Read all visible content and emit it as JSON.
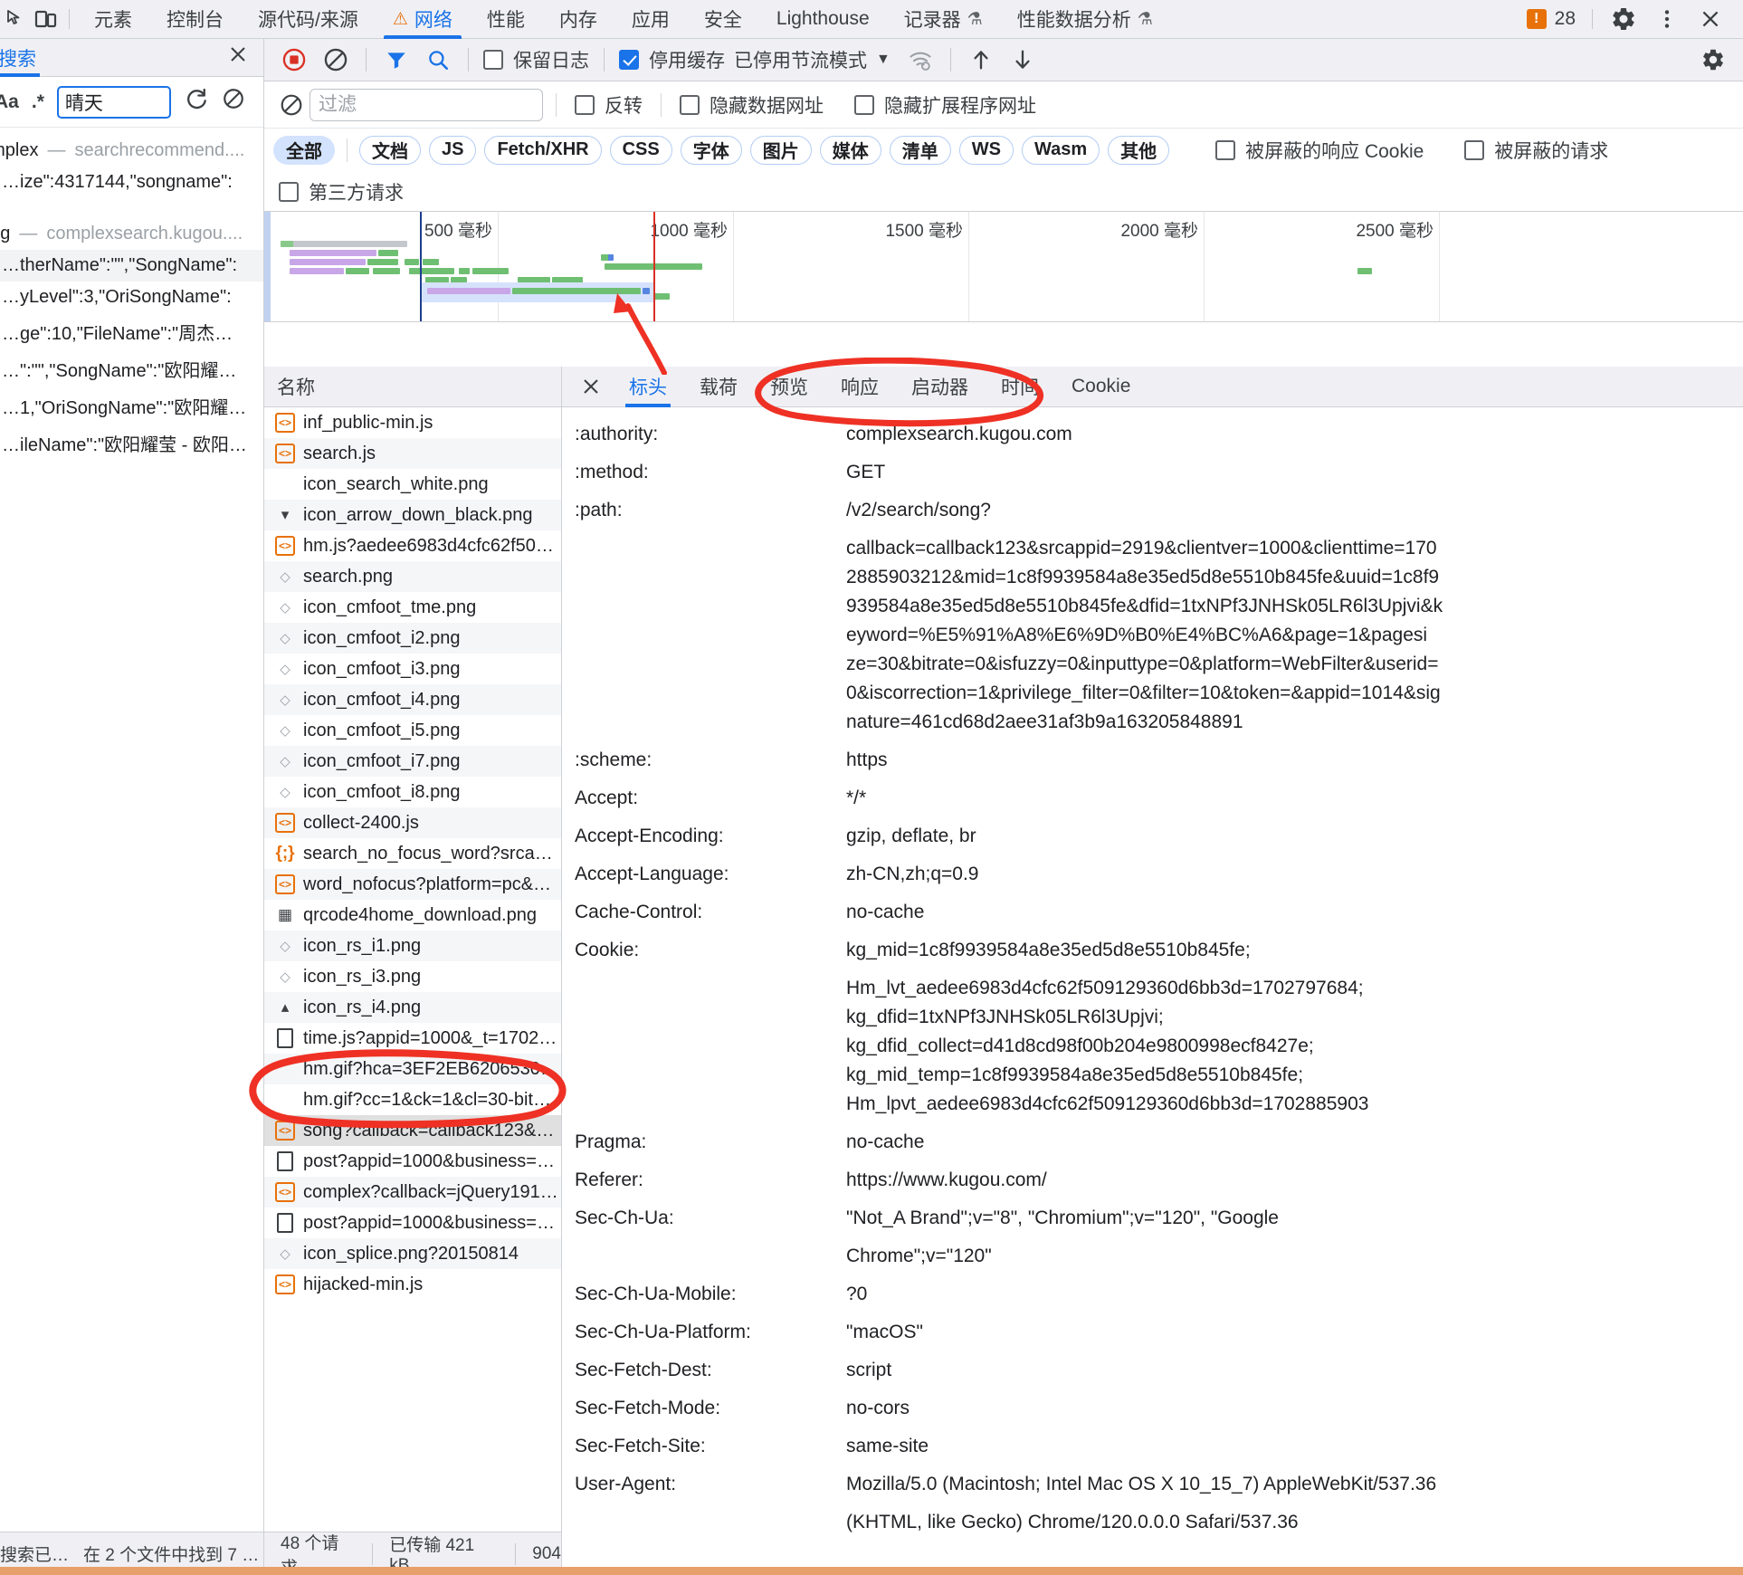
{
  "topbar": {
    "inspect_icon": "inspect-cursor-icon",
    "device_icon": "device-toolbar-icon",
    "tabs": [
      {
        "label": "元素",
        "active": false,
        "warn": false,
        "flask": false
      },
      {
        "label": "控制台",
        "active": false,
        "warn": false,
        "flask": false
      },
      {
        "label": "源代码/来源",
        "active": false,
        "warn": false,
        "flask": false
      },
      {
        "label": "网络",
        "active": true,
        "warn": true,
        "flask": false
      },
      {
        "label": "性能",
        "active": false,
        "warn": false,
        "flask": false
      },
      {
        "label": "内存",
        "active": false,
        "warn": false,
        "flask": false
      },
      {
        "label": "应用",
        "active": false,
        "warn": false,
        "flask": false
      },
      {
        "label": "安全",
        "active": false,
        "warn": false,
        "flask": false
      },
      {
        "label": "Lighthouse",
        "active": false,
        "warn": false,
        "flask": false
      },
      {
        "label": "记录器",
        "active": false,
        "warn": false,
        "flask": true
      },
      {
        "label": "性能数据分析",
        "active": false,
        "warn": false,
        "flask": true
      }
    ],
    "error_count": "28",
    "error_glyph": "!",
    "settings_icon": "gear-icon",
    "more_icon": "kebab-menu-icon",
    "close_icon": "close-icon"
  },
  "search_panel": {
    "tab_label": "搜索",
    "close_icon": "close-icon",
    "match_case_label": "Aa",
    "regex_label": ".*",
    "query_value": "晴天",
    "refresh_icon": "refresh-icon",
    "clear_icon": "clear-icon",
    "groups": [
      {
        "file": "complex",
        "dash": "—",
        "url": "searchrecommend....",
        "matches": [
          {
            "text": "…ize\":4317144,\"songname\":",
            "highlight": "…",
            "selected": false
          }
        ]
      },
      {
        "file": "song",
        "dash": "—",
        "url": "complexsearch.kugou....",
        "matches": [
          {
            "text": "…therName\":\"\",\"SongName\":",
            "highlight": "…",
            "selected": true
          },
          {
            "text": "…yLevel\":3,\"OriSongName\":",
            "highlight": "…",
            "selected": false
          },
          {
            "text": "…ge\":10,\"FileName\":\"周杰…",
            "highlight": "",
            "selected": false
          },
          {
            "text": "…\":\"\",\"SongName\":\"欧阳耀…",
            "highlight": "",
            "selected": false
          },
          {
            "text": "…1,\"OriSongName\":\"欧阳耀…",
            "highlight": "",
            "selected": false
          },
          {
            "text": "…ileName\":\"欧阳耀莹 - 欧阳…",
            "highlight": "",
            "selected": false
          }
        ]
      }
    ],
    "status_left": "搜索已…",
    "status_right": "在 2 个文件中找到 7 …"
  },
  "network": {
    "toolbar": {
      "record_icon": "record-stop-icon",
      "clear_icon": "clear-network-icon",
      "filter_icon": "filter-funnel-icon",
      "search_icon": "search-icon",
      "preserve_log": {
        "label": "保留日志",
        "checked": false
      },
      "disable_cache": {
        "label": "停用缓存",
        "checked": true
      },
      "throttle_label": "已停用节流模式",
      "throttle_caret": "▼",
      "wifi_icon": "network-conditions-icon",
      "import_icon": "import-har-icon",
      "export_icon": "export-har-icon",
      "settings_icon": "gear-icon"
    },
    "filterbar": {
      "filter_placeholder": "过滤",
      "filter_value": "",
      "invert": {
        "label": "反转",
        "checked": false
      },
      "hide_data_urls": {
        "label": "隐藏数据网址",
        "checked": false
      },
      "hide_ext_urls": {
        "label": "隐藏扩展程序网址",
        "checked": false
      }
    },
    "type_chips": [
      "全部",
      "文档",
      "JS",
      "Fetch/XHR",
      "CSS",
      "字体",
      "图片",
      "媒体",
      "清单",
      "WS",
      "Wasm",
      "其他"
    ],
    "active_chip": "全部",
    "blocked_response_cookies": {
      "label": "被屏蔽的响应 Cookie",
      "checked": false
    },
    "blocked_requests": {
      "label": "被屏蔽的请求",
      "checked": false
    },
    "third_party": {
      "label": "第三方请求",
      "checked": false
    },
    "overview_ticks": [
      "500 毫秒",
      "1000 毫秒",
      "1500 毫秒",
      "2000 毫秒",
      "2500 毫秒"
    ],
    "name_column_header": "名称",
    "requests": [
      {
        "name": "inf_public-min.js",
        "icon": "js-file-icon"
      },
      {
        "name": "search.js",
        "icon": "js-file-icon"
      },
      {
        "name": "icon_search_white.png",
        "icon": "blank-icon"
      },
      {
        "name": "icon_arrow_down_black.png",
        "icon": "chevron-down-icon"
      },
      {
        "name": "hm.js?aedee6983d4cfc62f50…",
        "icon": "js-file-icon"
      },
      {
        "name": "search.png",
        "icon": "image-icon"
      },
      {
        "name": "icon_cmfoot_tme.png",
        "icon": "image-icon"
      },
      {
        "name": "icon_cmfoot_i2.png",
        "icon": "image-icon"
      },
      {
        "name": "icon_cmfoot_i3.png",
        "icon": "image-icon"
      },
      {
        "name": "icon_cmfoot_i4.png",
        "icon": "image-icon"
      },
      {
        "name": "icon_cmfoot_i5.png",
        "icon": "image-icon"
      },
      {
        "name": "icon_cmfoot_i7.png",
        "icon": "image-icon"
      },
      {
        "name": "icon_cmfoot_i8.png",
        "icon": "image-icon"
      },
      {
        "name": "collect-2400.js",
        "icon": "js-file-icon"
      },
      {
        "name": "search_no_focus_word?srca…",
        "icon": "json-file-icon"
      },
      {
        "name": "word_nofocus?platform=pc&…",
        "icon": "js-file-icon"
      },
      {
        "name": "qrcode4home_download.png",
        "icon": "qr-image-icon"
      },
      {
        "name": "icon_rs_i1.png",
        "icon": "image-icon"
      },
      {
        "name": "icon_rs_i3.png",
        "icon": "image-icon"
      },
      {
        "name": "icon_rs_i4.png",
        "icon": "chevron-up-icon"
      },
      {
        "name": "time.js?appid=1000&_t=1702…",
        "icon": "doc-file-icon"
      },
      {
        "name": "hm.gif?hca=3EF2EB6206530…",
        "icon": "blank-icon"
      },
      {
        "name": "hm.gif?cc=1&ck=1&cl=30-bit…",
        "icon": "blank-icon"
      },
      {
        "name": "song?callback=callback123&…",
        "icon": "js-file-icon",
        "selected": true
      },
      {
        "name": "post?appid=1000&business=…",
        "icon": "doc-file-icon"
      },
      {
        "name": "complex?callback=jQuery191…",
        "icon": "js-file-icon"
      },
      {
        "name": "post?appid=1000&business=…",
        "icon": "doc-file-icon"
      },
      {
        "name": "icon_splice.png?20150814",
        "icon": "image-icon"
      },
      {
        "name": "hijacked-min.js",
        "icon": "js-file-icon"
      }
    ],
    "footer": {
      "requests_count": "48 个请求",
      "transferred": "已传输 421 kB",
      "resources": "904"
    },
    "detail": {
      "close_icon": "close-icon",
      "tabs": [
        "标头",
        "载荷",
        "预览",
        "响应",
        "启动器",
        "时间",
        "Cookie"
      ],
      "active_tab": "标头",
      "headers": [
        {
          "key": ":authority:",
          "lines": [
            "complexsearch.kugou.com"
          ]
        },
        {
          "key": ":method:",
          "lines": [
            "GET"
          ]
        },
        {
          "key": ":path:",
          "lines": [
            "/v2/search/song?",
            "callback=callback123&srcappid=2919&clientver=1000&clienttime=170",
            "2885903212&mid=1c8f9939584a8e35ed5d8e5510b845fe&uuid=1c8f9",
            "939584a8e35ed5d8e5510b845fe&dfid=1txNPf3JNHSk05LR6l3Upjvi&k",
            "eyword=%E5%91%A8%E6%9D%B0%E4%BC%A6&page=1&pagesi",
            "ze=30&bitrate=0&isfuzzy=0&inputtype=0&platform=WebFilter&userid=",
            "0&iscorrection=1&privilege_filter=0&filter=10&token=&appid=1014&sig",
            "nature=461cd68d2aee31af3b9a163205848891"
          ]
        },
        {
          "key": ":scheme:",
          "lines": [
            "https"
          ]
        },
        {
          "key": "Accept:",
          "lines": [
            "*/*"
          ]
        },
        {
          "key": "Accept-Encoding:",
          "lines": [
            "gzip, deflate, br"
          ]
        },
        {
          "key": "Accept-Language:",
          "lines": [
            "zh-CN,zh;q=0.9"
          ]
        },
        {
          "key": "Cache-Control:",
          "lines": [
            "no-cache"
          ]
        },
        {
          "key": "Cookie:",
          "lines": [
            "kg_mid=1c8f9939584a8e35ed5d8e5510b845fe;",
            "Hm_lvt_aedee6983d4cfc62f509129360d6bb3d=1702797684;",
            "kg_dfid=1txNPf3JNHSk05LR6l3Upjvi;",
            "kg_dfid_collect=d41d8cd98f00b204e9800998ecf8427e;",
            "kg_mid_temp=1c8f9939584a8e35ed5d8e5510b845fe;",
            "Hm_lpvt_aedee6983d4cfc62f509129360d6bb3d=1702885903"
          ]
        },
        {
          "key": "Pragma:",
          "lines": [
            "no-cache"
          ]
        },
        {
          "key": "Referer:",
          "lines": [
            "https://www.kugou.com/"
          ]
        },
        {
          "key": "Sec-Ch-Ua:",
          "lines": [
            "\"Not_A Brand\";v=\"8\", \"Chromium\";v=\"120\", \"Google",
            "Chrome\";v=\"120\""
          ]
        },
        {
          "key": "Sec-Ch-Ua-Mobile:",
          "lines": [
            "?0"
          ]
        },
        {
          "key": "Sec-Ch-Ua-Platform:",
          "lines": [
            "\"macOS\""
          ]
        },
        {
          "key": "Sec-Fetch-Dest:",
          "lines": [
            "script"
          ]
        },
        {
          "key": "Sec-Fetch-Mode:",
          "lines": [
            "no-cors"
          ]
        },
        {
          "key": "Sec-Fetch-Site:",
          "lines": [
            "same-site"
          ]
        },
        {
          "key": "User-Agent:",
          "lines": [
            "Mozilla/5.0 (Macintosh; Intel Mac OS X 10_15_7) AppleWebKit/537.36",
            "(KHTML, like Gecko) Chrome/120.0.0.0 Safari/537.36"
          ]
        }
      ]
    }
  },
  "annotations": {
    "marker_color": "#ee3124",
    "circle_tabs": "hand-drawn-ellipse-around-detail-tabs",
    "circle_request": "hand-drawn-ellipse-around-selected-request"
  }
}
